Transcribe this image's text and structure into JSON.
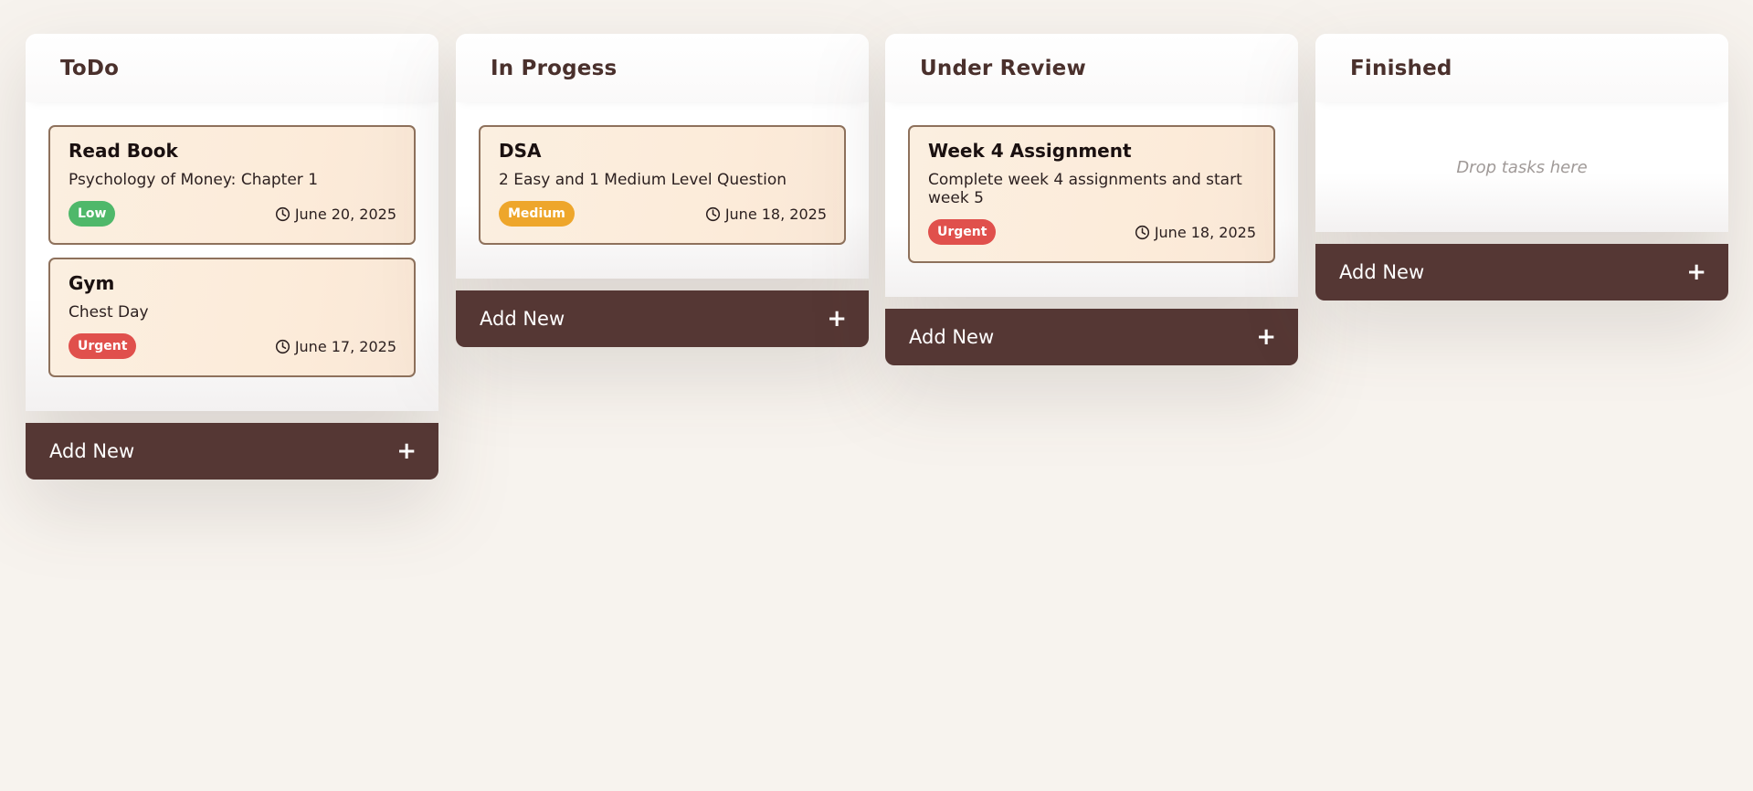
{
  "columns": [
    {
      "title": "ToDo",
      "add_label": "Add New",
      "tasks": [
        {
          "title": "Read Book",
          "description": "Psychology of Money: Chapter 1",
          "priority": "Low",
          "date": "June 20, 2025"
        },
        {
          "title": "Gym",
          "description": "Chest Day",
          "priority": "Urgent",
          "date": "June 17, 2025"
        }
      ]
    },
    {
      "title": "In Progess",
      "add_label": "Add New",
      "tasks": [
        {
          "title": "DSA",
          "description": "2 Easy and 1 Medium Level Question",
          "priority": "Medium",
          "date": "June 18, 2025"
        }
      ]
    },
    {
      "title": "Under Review",
      "add_label": "Add New",
      "tasks": [
        {
          "title": "Week 4 Assignment",
          "description": "Complete week 4 assignments and start week 5",
          "priority": "Urgent",
          "date": "June 18, 2025"
        }
      ]
    },
    {
      "title": "Finished",
      "add_label": "Add New",
      "empty_text": "Drop tasks here",
      "tasks": []
    }
  ],
  "icons": {
    "date": "clock-icon",
    "add": "plus-icon"
  },
  "priority_colors": {
    "Low": "#4fb86a",
    "Medium": "#eea62b",
    "Urgent": "#e0504c"
  },
  "add_icon_glyph": "+"
}
